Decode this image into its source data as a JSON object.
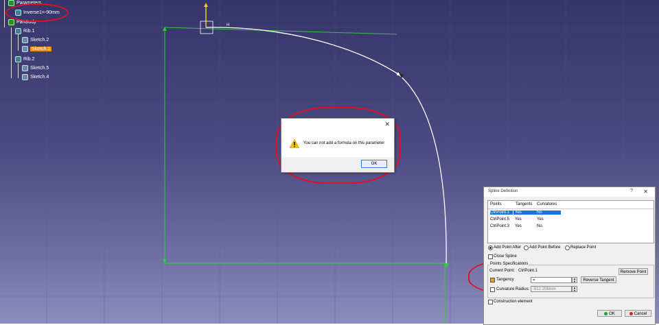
{
  "tree": {
    "parameters": "Parameters",
    "parameter_inverse": "Inverse1=-90mm",
    "partbody": "PartBody",
    "rib1": "Rib.1",
    "sketch2": "Sketch.2",
    "sketch1_selected": "Sketch.1",
    "rib2": "Rib.2",
    "sketch5": "Sketch.5",
    "sketch4": "Sketch.4"
  },
  "viewport": {
    "axis_h_label": "H",
    "axis_v_label": "V"
  },
  "message_box": {
    "close": "✕",
    "text": "You can not add a formula on this parameter",
    "ok": "OK"
  },
  "spline_dialog": {
    "title": "Spline Definition",
    "help": "?",
    "close": "✕",
    "columns": [
      "Points",
      "Tangents",
      "Curvatures"
    ],
    "rows": [
      {
        "point": "CtrlPoint.1",
        "tangent": "Yes",
        "curvature": "No"
      },
      {
        "point": "CtrlPoint.5",
        "tangent": "Yes",
        "curvature": "Yes"
      },
      {
        "point": "CtrlPoint.3",
        "tangent": "Yes",
        "curvature": "No"
      }
    ],
    "radio_add_after": "Add Point After",
    "radio_add_before": "Add Point Before",
    "radio_replace": "Replace Point",
    "close_spline": "Close Spline",
    "group_title": "Points Specifications",
    "current_point_label": "Current Point:",
    "current_point_value": "CtrlPoint.1",
    "remove_point": "Remove Point",
    "tangency_label": "Tangency",
    "tangency_value": "=",
    "reverse_tangent": "Reverse Tangent",
    "curvature_label": "Curvature Radius:",
    "curvature_value": "-512.206mm",
    "construction": "Construction element",
    "ok": "OK",
    "cancel": "Cancel"
  },
  "colors": {
    "accent_red": "#e01020",
    "selection_blue": "#1a73d8",
    "sketch_green": "#2ecc40",
    "selected_orange": "#f08a1a"
  }
}
